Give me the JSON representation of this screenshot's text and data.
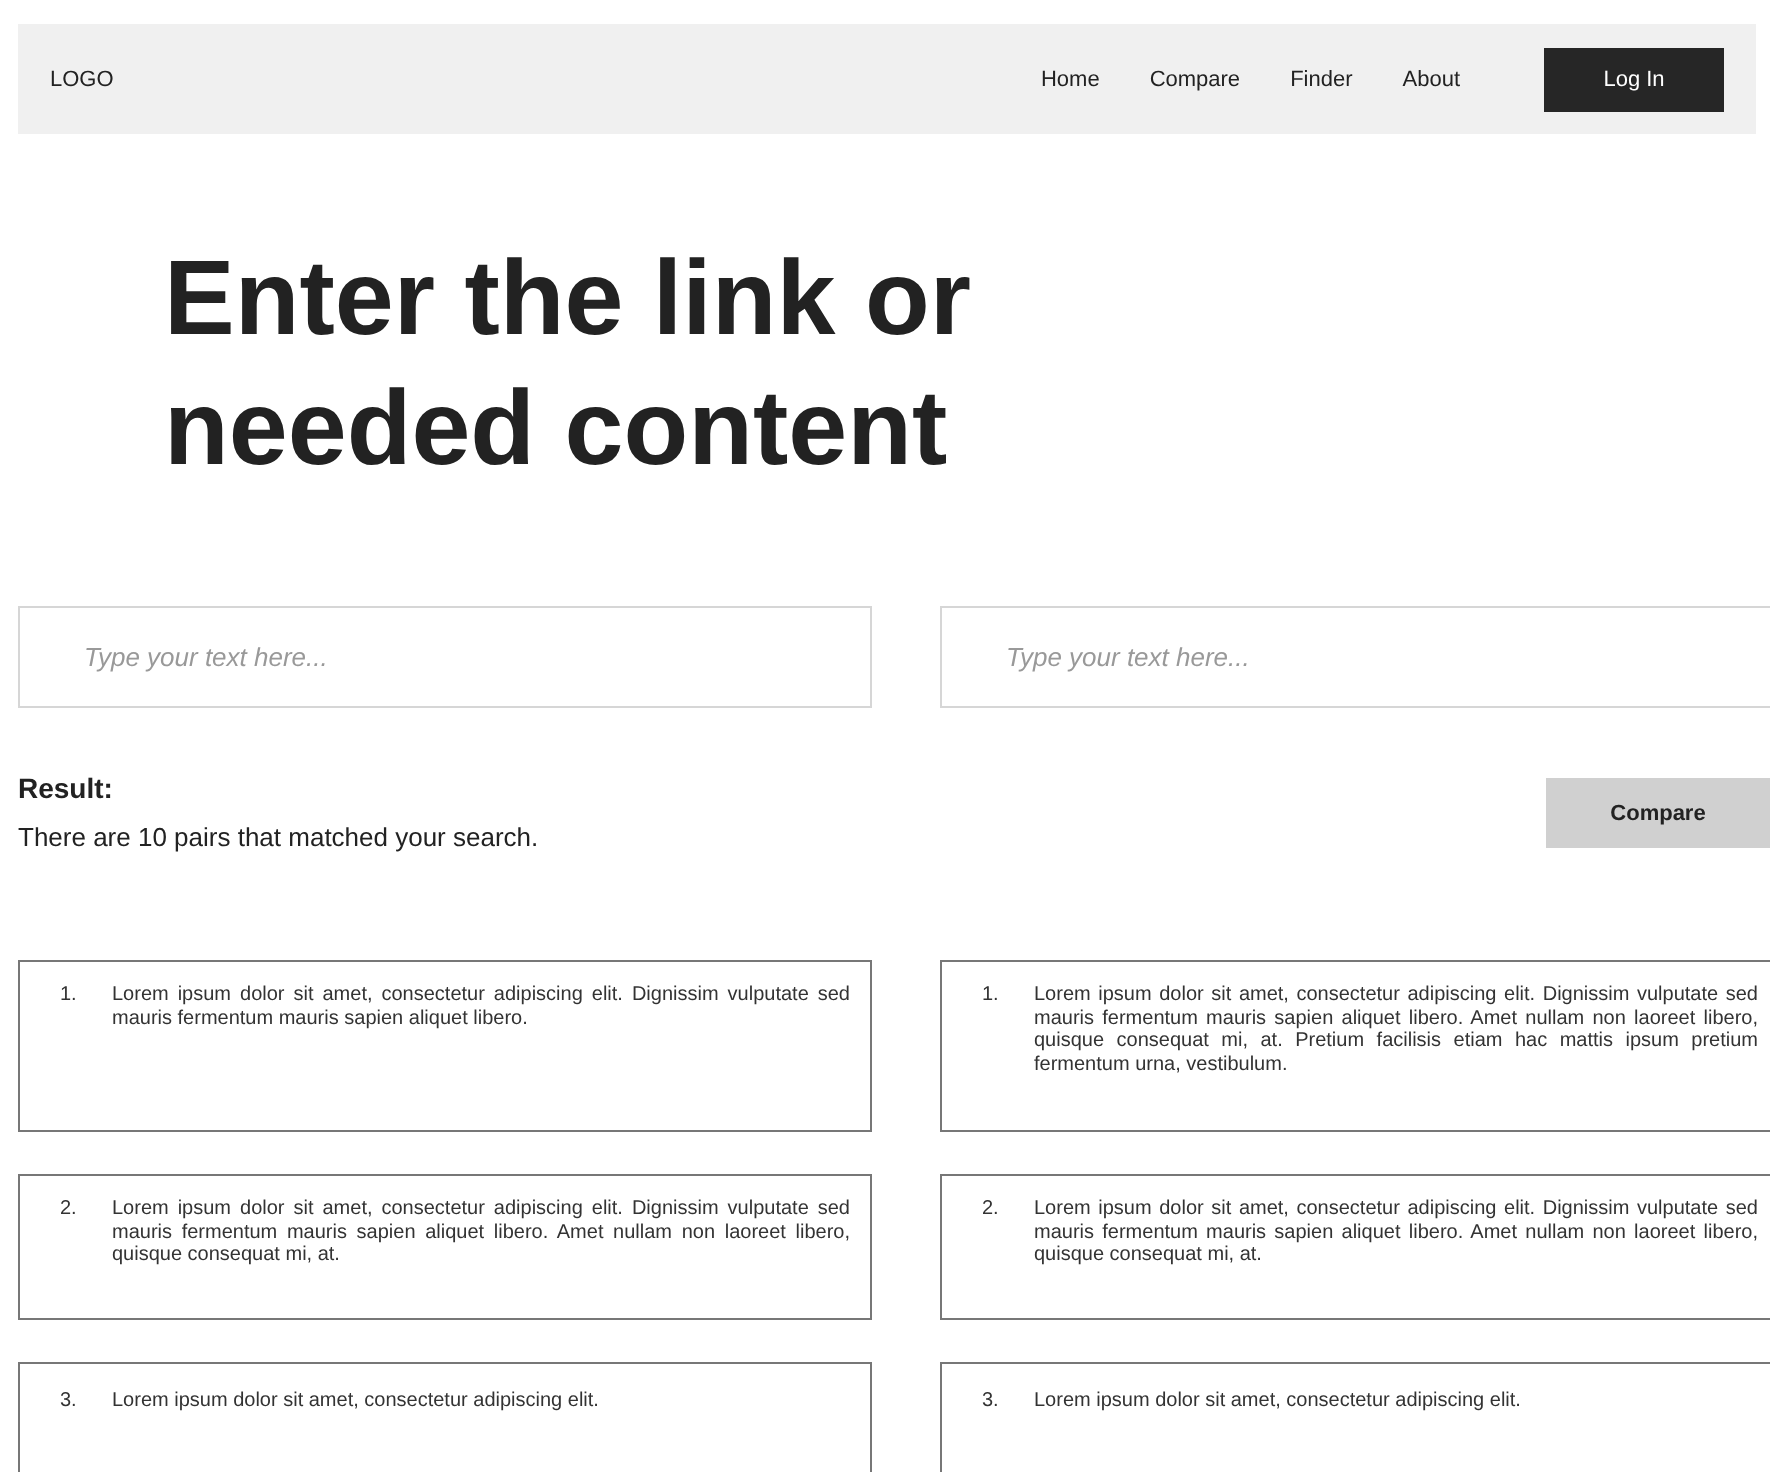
{
  "navbar": {
    "logo": "LOGO",
    "links": [
      "Home",
      "Compare",
      "Finder",
      "About"
    ],
    "login_button": "Log In"
  },
  "heading": [
    "Enter the link or",
    "needed content"
  ],
  "inputs": [
    {
      "placeholder": "Type your text here..."
    },
    {
      "placeholder": "Type your text here..."
    }
  ],
  "result": {
    "title": "Result:",
    "summary": "There are 10 pairs that matched your search.",
    "compare_button": "Compare"
  },
  "pairs": [
    {
      "left": {
        "number": "1.",
        "text": "Lorem ipsum dolor sit amet, consectetur adipiscing elit. Dignissim vulputate sed mauris fermentum mauris sapien aliquet libero."
      },
      "right": {
        "number": "1.",
        "text": "Lorem ipsum dolor sit amet, consectetur adipiscing elit. Dignissim vulputate sed mauris fermentum mauris sapien aliquet libero. Amet nullam non laoreet libero, quisque consequat mi, at. Pretium facilisis etiam hac mattis ipsum pretium fermentum urna, vestibulum."
      }
    },
    {
      "left": {
        "number": "2.",
        "text": "Lorem ipsum dolor sit amet, consectetur adipiscing elit. Dignissim vulputate sed mauris fermentum mauris sapien aliquet libero. Amet nullam non laoreet libero, quisque consequat mi, at."
      },
      "right": {
        "number": "2.",
        "text": "Lorem ipsum dolor sit amet, consectetur adipiscing elit. Dignissim vulputate sed mauris fermentum mauris sapien aliquet libero. Amet nullam non laoreet libero, quisque consequat mi, at."
      }
    },
    {
      "left": {
        "number": "3.",
        "text": "Lorem ipsum dolor sit amet, consectetur adipiscing elit."
      },
      "right": {
        "number": "3.",
        "text": "Lorem ipsum dolor sit amet, consectetur adipiscing elit."
      }
    }
  ]
}
